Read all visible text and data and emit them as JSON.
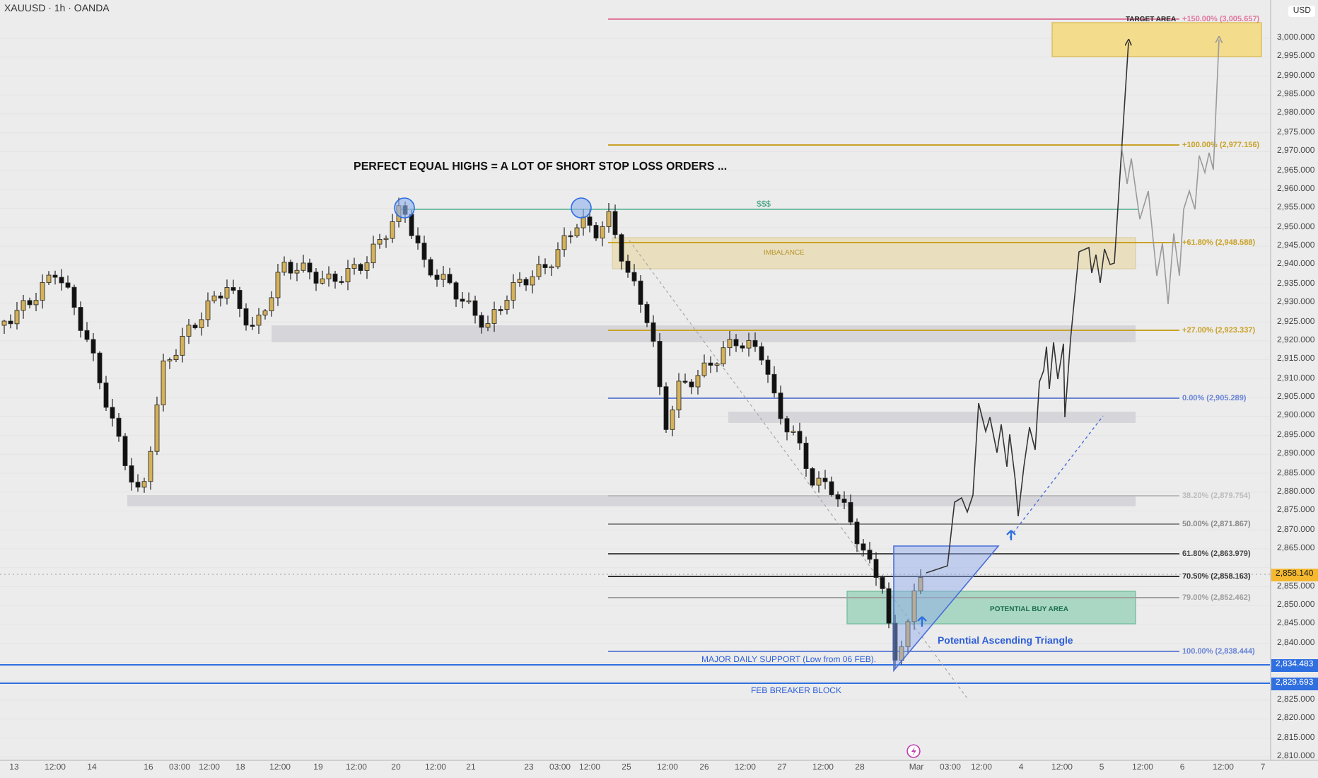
{
  "header": {
    "symbol": "XAUUSD · 1h · OANDA"
  },
  "annotations": [
    {
      "kind": "headline",
      "text": "PERFECT EQUAL HIGHS = A LOT OF SHORT STOP LOSS ORDERS ..."
    },
    {
      "kind": "liquidity",
      "text": "$$$"
    },
    {
      "kind": "imbalance",
      "text": "IMBALANCE"
    },
    {
      "kind": "target",
      "text": "TARGET AREA"
    },
    {
      "kind": "buy",
      "text": "POTENTIAL BUY AREA"
    },
    {
      "kind": "pattern",
      "text": "Potential Ascending Triangle"
    },
    {
      "kind": "support",
      "text": "MAJOR DAILY SUPPORT (Low from 06 FEB)."
    },
    {
      "kind": "support",
      "text": "FEB BREAKER BLOCK"
    }
  ],
  "fib_levels": [
    {
      "label": "+150.00% (3,005.657)",
      "color": "#e07aa0"
    },
    {
      "label": "+100.00% (2,977.156)",
      "color": "#c9a227"
    },
    {
      "label": "+61.80% (2,948.588)",
      "color": "#c9a227"
    },
    {
      "label": "+27.00% (2,923.337)",
      "color": "#c9a227"
    },
    {
      "label": "0.00% (2,905.289)",
      "color": "#6a85d6"
    },
    {
      "label": "38.20% (2,879.754)",
      "color": "#bdbdbd"
    },
    {
      "label": "50.00% (2,871.867)",
      "color": "#8a8a8a"
    },
    {
      "label": "61.80% (2,863.979)",
      "color": "#4a4a4a"
    },
    {
      "label": "70.50% (2,858.163)",
      "color": "#333333"
    },
    {
      "label": "79.00% (2,852.462)",
      "color": "#a0a0a0"
    },
    {
      "label": "100.00% (2,838.444)",
      "color": "#6a85d6"
    }
  ],
  "price_axis": {
    "currency": "USD",
    "ticks": [
      "3,000.000",
      "2,995.000",
      "2,990.000",
      "2,985.000",
      "2,980.000",
      "2,975.000",
      "2,970.000",
      "2,965.000",
      "2,960.000",
      "2,955.000",
      "2,950.000",
      "2,945.000",
      "2,940.000",
      "2,935.000",
      "2,930.000",
      "2,925.000",
      "2,920.000",
      "2,915.000",
      "2,910.000",
      "2,905.000",
      "2,900.000",
      "2,895.000",
      "2,890.000",
      "2,885.000",
      "2,880.000",
      "2,875.000",
      "2,870.000",
      "2,865.000",
      "2,855.000",
      "2,850.000",
      "2,845.000",
      "2,840.000",
      "2,825.000",
      "2,820.000",
      "2,815.000",
      "2,810.000"
    ],
    "markers": [
      {
        "label": "2,858.140",
        "kind": "current"
      },
      {
        "label": "2,834.483",
        "kind": "level"
      },
      {
        "label": "2,829.693",
        "kind": "level"
      }
    ]
  },
  "time_axis": {
    "ticks": [
      "13",
      "12:00",
      "14",
      "16",
      "03:00",
      "12:00",
      "18",
      "12:00",
      "19",
      "12:00",
      "20",
      "12:00",
      "21",
      "23",
      "03:00",
      "12:00",
      "25",
      "12:00",
      "26",
      "12:00",
      "27",
      "12:00",
      "28",
      "Mar",
      "03:00",
      "12:00",
      "4",
      "12:00",
      "5",
      "12:00",
      "6",
      "12:00",
      "7"
    ]
  }
}
